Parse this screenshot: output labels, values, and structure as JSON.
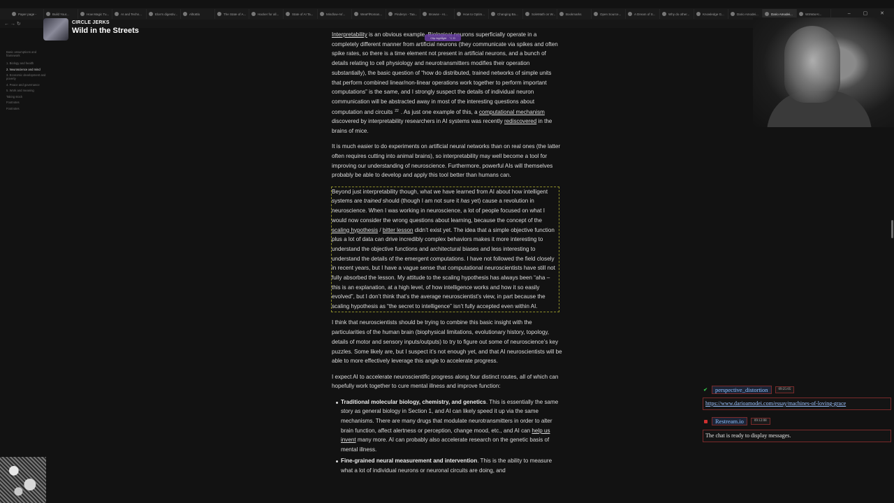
{
  "browser": {
    "tabs": [
      "Paper page -",
      "Build Your...",
      "How Magic Tu...",
      "AI and Techn...",
      "Elon's digestiv...",
      "AlltoBlo",
      "The State of A...",
      "Hacker for all...",
      "State of AI Ta...",
      "Mindlow-AI/...",
      "WeaFlRoman...",
      "Pinderys - Taa...",
      "Browse - AI...",
      "How to Optim...",
      "Changing Ba...",
      "SoleMath on W...",
      "Bookmarks",
      "Open Source...",
      "A Dream of S...",
      "Why do other...",
      "Knowledge G...",
      "Dario Amodei...",
      "Dario Amodei...",
      "WSWarAI..."
    ],
    "active_tab_index": 22,
    "window_controls": "– ▢ ✕",
    "nav_icons": "← → ↻"
  },
  "overlay": {
    "kicker": "CIRCLE JERKS",
    "title": "Wild in the Streets"
  },
  "toc": {
    "items": [
      "Basic assumptions and framework",
      "1. Biology and health",
      "2. Neuroscience and mind",
      "3. Economic development and poverty",
      "4. Peace and governance",
      "5. Work and meaning",
      "Taking stock",
      "Footnotes",
      "Footnotes"
    ],
    "current_index": 2
  },
  "clip_popup": {
    "label": "Clip highlight",
    "shortcut": "⌥ D"
  },
  "article": {
    "p1": {
      "link1": "Interpretability",
      "t1": " is an obvious example. Biological neurons superficially operate in a completely different manner from artificial neurons (they communicate via spikes and often spike rates, so there is a time element not present in artificial neurons, and a bunch of details relating to cell physiology and neurotransmitters modifies their operation substantially), the basic question of “how do distributed, trained networks of simple units that perform combined linear/non-linear operations work together to perform important computations” is the same, and I strongly suspect the details of individual neuron communication will be abstracted away in most of the interesting questions about computation and circuits",
      "footnote": "22",
      "t2": ". As just one example of this, a ",
      "link2": "computational mechanism",
      "t3": " discovered by interpretability researchers in AI systems was recently ",
      "link3": "rediscovered",
      "t4": " in the brains of mice."
    },
    "p2": "It is much easier to do experiments on artificial neural networks than on real ones (the latter often requires cutting into animal brains), so interpretability may well become a tool for improving our understanding of neuroscience. Furthermore, powerful AIs will themselves probably be able to develop and apply this tool better than humans can.",
    "p3": {
      "t1": "Beyond just interpretability though, what we have learned from AI about how intelligent systems are ",
      "em1": "trained",
      "t2": " should (though I am not sure it ",
      "em2": "has",
      "t3": " yet) cause a revolution in neuroscience. When I was working in neuroscience, a lot of people focused on what I would now consider the wrong questions about learning, because the concept of the ",
      "link1": "scaling hypothesis",
      "sep": " / ",
      "link2": "bitter lesson",
      "t4": " didn’t exist yet. The idea that a simple objective function plus a lot of data can drive incredibly complex behaviors makes it more interesting to understand the objective functions and architectural biases and less interesting to understand the details of the emergent computations. I have not followed the field closely in recent years, but I have a vague sense that computational neuroscientists have still not fully absorbed the lesson. My attitude to the scaling hypothesis has always been “aha – this is an explanation, at a high level, of how intelligence works and how it so easily evolved”, but I don’t think that’s the average neuroscientist’s view, in part because the scaling hypothesis as “the secret to intelligence” isn’t fully accepted even within AI."
    },
    "p4": "I think that neuroscientists should be trying to combine this basic insight with the particularities of the human brain (biophysical limitations, evolutionary history, topology, details of motor and sensory inputs/outputs) to try to figure out some of neuroscience’s key puzzles. Some likely are, but I suspect it’s not enough yet, and that AI neuroscientists will be able to more effectively leverage this angle to accelerate progress.",
    "p5": "I expect AI to accelerate neuroscientific progress along four distinct routes, all of which can hopefully work together to cure mental illness and improve function:",
    "li1": {
      "bold": "Traditional molecular biology, chemistry, and genetics",
      "t1": ". This is essentially the same story as general biology in Section 1, and AI can likely speed it up via the same mechanisms. There are many drugs that modulate neurotransmitters in order to alter brain function, affect alertness or perception, change mood, etc., and AI can ",
      "link": "help us invent",
      "t2": " many more. AI can probably also accelerate research on the genetic basis of mental illness."
    },
    "li2": {
      "bold": "Fine-grained neural measurement and intervention",
      "t1": ". This is the ability to measure what a lot of individual neurons or neuronal circuits are doing, and"
    }
  },
  "chat": {
    "messages": [
      {
        "user": "perspective_distortion",
        "time": "09:25:05",
        "text": "https://www.darioamodei.com/essay/machines-of-loving-grace",
        "icon": "green-checkmark-icon"
      },
      {
        "user": "Restream.io",
        "time": "09:12:08",
        "text": "The chat is ready to display messages.",
        "icon": "restream-icon"
      }
    ]
  },
  "colors": {
    "page_bg": "#121212",
    "text": "#dcdcdc",
    "highlight_border": "#8c8c2a",
    "chat_border": "#7a2a2a",
    "chat_user": "#8fc0ff"
  }
}
